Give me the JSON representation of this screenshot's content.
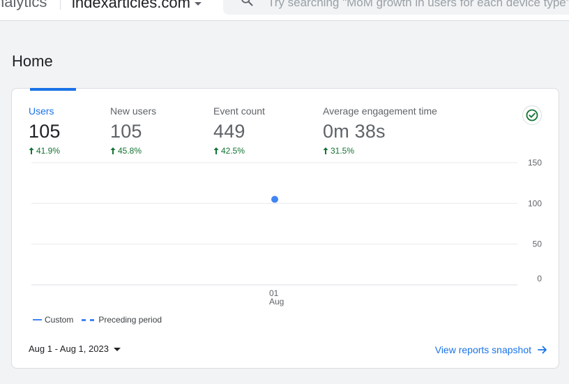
{
  "topbar": {
    "product_name": "nalytics",
    "property_name": "indexarticles.com",
    "search_placeholder": "Try searching \"MoM growth in users for each device type\""
  },
  "page_title": "Home",
  "metrics": [
    {
      "label": "Users",
      "value": "105",
      "change": "41.9%",
      "direction": "up",
      "active": true
    },
    {
      "label": "New users",
      "value": "105",
      "change": "45.8%",
      "direction": "up",
      "active": false
    },
    {
      "label": "Event count",
      "value": "449",
      "change": "42.5%",
      "direction": "up",
      "active": false
    },
    {
      "label": "Average engagement time",
      "value": "0m 38s",
      "change": "31.5%",
      "direction": "up",
      "active": false
    }
  ],
  "chart_data": {
    "type": "line",
    "x": [
      "01 Aug"
    ],
    "series": [
      {
        "name": "Custom",
        "values": [
          105
        ],
        "style": "solid"
      },
      {
        "name": "Preceding period",
        "values": [],
        "style": "dashed"
      }
    ],
    "y_ticks": [
      "0",
      "50",
      "100",
      "150"
    ],
    "x_tick_day": "01",
    "x_tick_month": "Aug",
    "ylim": [
      0,
      150
    ],
    "grid": true,
    "legend_position": "bottom-left"
  },
  "legend": {
    "custom_label": "Custom",
    "preceding_label": "Preceding period"
  },
  "footer": {
    "date_range": "Aug 1 - Aug 1, 2023",
    "view_link": "View reports snapshot"
  },
  "colors": {
    "accent": "#1a73e8",
    "series": "#4285f4",
    "positive": "#137333",
    "grid": "#e8eaed"
  },
  "icons": {
    "search": "search-icon",
    "check": "check-circle-icon",
    "arrow_right": "arrow-right-icon",
    "arrow_up": "arrow-up-icon"
  }
}
